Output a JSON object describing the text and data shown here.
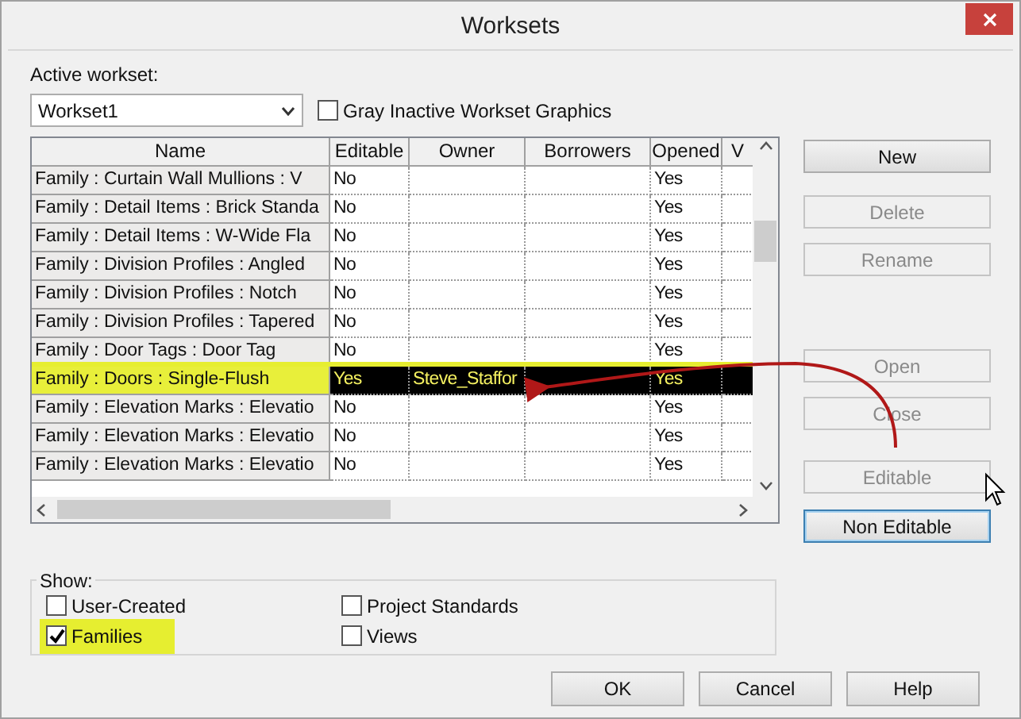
{
  "window": {
    "title": "Worksets"
  },
  "active_workset": {
    "label": "Active workset:",
    "value": "Workset1"
  },
  "gray_inactive": {
    "label": "Gray Inactive Workset Graphics",
    "checked": false
  },
  "table": {
    "columns": [
      "Name",
      "Editable",
      "Owner",
      "Borrowers",
      "Opened",
      "V"
    ],
    "rows": [
      {
        "cells": [
          "Family  : Curtain Wall Mullions : V",
          "No",
          "",
          "",
          "Yes"
        ],
        "selected": false,
        "highlighted": false
      },
      {
        "cells": [
          "Family  : Detail Items : Brick Standa",
          "No",
          "",
          "",
          "Yes"
        ],
        "selected": false,
        "highlighted": false
      },
      {
        "cells": [
          "Family  : Detail Items : W-Wide Fla",
          "No",
          "",
          "",
          "Yes"
        ],
        "selected": false,
        "highlighted": false
      },
      {
        "cells": [
          "Family  : Division Profiles : Angled",
          "No",
          "",
          "",
          "Yes"
        ],
        "selected": false,
        "highlighted": false
      },
      {
        "cells": [
          "Family  : Division Profiles : Notch",
          "No",
          "",
          "",
          "Yes"
        ],
        "selected": false,
        "highlighted": false
      },
      {
        "cells": [
          "Family  : Division Profiles : Tapered",
          "No",
          "",
          "",
          "Yes"
        ],
        "selected": false,
        "highlighted": false
      },
      {
        "cells": [
          "Family  : Door Tags : Door Tag",
          "No",
          "",
          "",
          "Yes"
        ],
        "selected": false,
        "highlighted": false
      },
      {
        "cells": [
          "Family  : Doors : Single-Flush",
          "Yes",
          "Steve_Staffor",
          "",
          "Yes"
        ],
        "selected": true,
        "highlighted": true
      },
      {
        "cells": [
          "Family  : Elevation Marks : Elevatio",
          "No",
          "",
          "",
          "Yes"
        ],
        "selected": false,
        "highlighted": false
      },
      {
        "cells": [
          "Family  : Elevation Marks : Elevatio",
          "No",
          "",
          "",
          "Yes"
        ],
        "selected": false,
        "highlighted": false
      },
      {
        "cells": [
          "Family  : Elevation Marks : Elevatio",
          "No",
          "",
          "",
          "Yes"
        ],
        "selected": false,
        "highlighted": false
      }
    ]
  },
  "buttons": [
    {
      "label": "New",
      "disabled": false,
      "focused": false
    },
    {
      "label": "Delete",
      "disabled": true,
      "focused": false
    },
    {
      "label": "Rename",
      "disabled": true,
      "focused": false
    },
    {
      "label": "Open",
      "disabled": true,
      "focused": false
    },
    {
      "label": "Close",
      "disabled": true,
      "focused": false
    },
    {
      "label": "Editable",
      "disabled": true,
      "focused": false
    },
    {
      "label": "Non Editable",
      "disabled": false,
      "focused": true
    }
  ],
  "show": {
    "label": "Show:",
    "options": [
      {
        "label": "User-Created",
        "checked": false,
        "highlighted": false
      },
      {
        "label": "Project Standards",
        "checked": false,
        "highlighted": false
      },
      {
        "label": "Families",
        "checked": true,
        "highlighted": true
      },
      {
        "label": "Views",
        "checked": false,
        "highlighted": false
      }
    ]
  },
  "dialog_buttons": [
    "OK",
    "Cancel",
    "Help"
  ]
}
